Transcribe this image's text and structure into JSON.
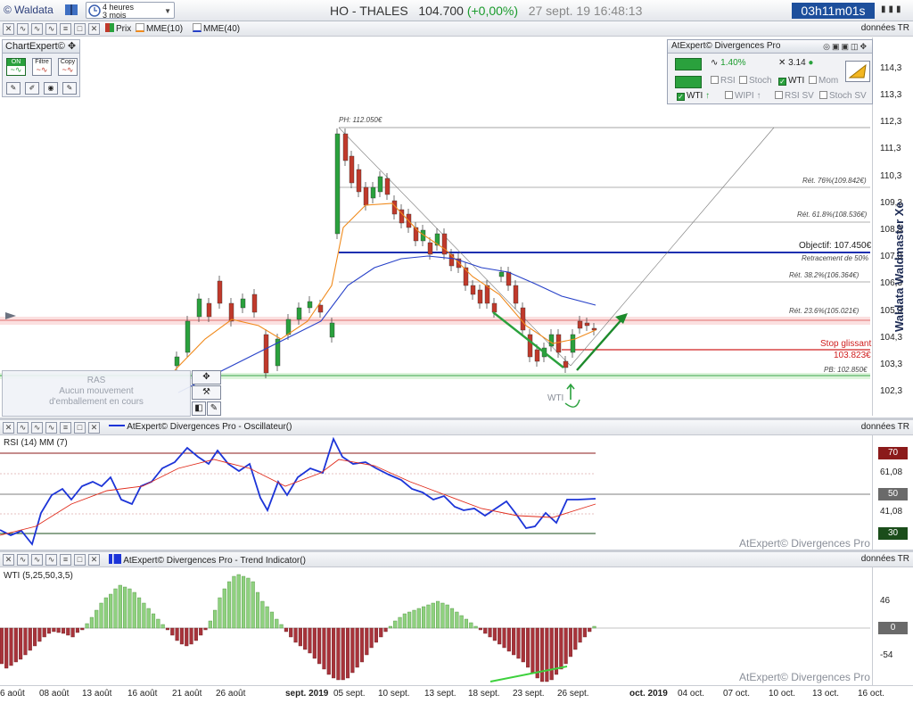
{
  "app": {
    "name": "© Waldata"
  },
  "period": {
    "line1": "4 heures",
    "line2": "3 mois"
  },
  "instrument": {
    "name": "HO - THALES",
    "price": "104.700",
    "change": "(+0,00%)",
    "datetime": "27 sept. 19 16:48:13"
  },
  "timer": "03h11m01s",
  "main_legend": {
    "price": "Prix",
    "ema10": "MME(10)",
    "ema40": "MME(40)",
    "realtime": "données TR"
  },
  "colors": {
    "ema10": "#f08a1c",
    "ema40": "#2640c8",
    "bull": "#2aa13d",
    "bear": "#c0392b",
    "rsi": "#1c34d8",
    "rsi_signal": "#e02a1a",
    "wti_up": "#8fd17f",
    "wti_down": "#a8333a",
    "timer_bg": "#1d4f9c"
  },
  "chartexpert": {
    "title": "ChartExpert©",
    "on": "ON",
    "filter": "Filtre",
    "copy": "Copy"
  },
  "atexpert": {
    "title": "AtExpert© Divergences Pro",
    "pct": "1.40%",
    "val": "3.14",
    "rsi": "RSI",
    "stoch": "Stoch",
    "wti": "WTI",
    "mom": "Mom",
    "wti2": "WTI",
    "wipi": "WIPI",
    "rsisv": "RSI SV",
    "stochsv": "Stoch SV"
  },
  "ras": {
    "title": "RAS",
    "line1": "Aucun mouvement",
    "line2": "d'emballement en cours"
  },
  "annotations": {
    "ph": "PH: 112.050€",
    "r76": "Rét. 76%(109.842€)",
    "r618": "Rét. 61.8%(108.536€)",
    "objectif": "Objectif: 107.450€",
    "retr50": "Retracement de 50%",
    "r382": "Rét. 38.2%(106.364€)",
    "r236": "Rét. 23.6%(105.021€)",
    "stop1": "Stop glissant",
    "stop2": "103.823€",
    "pb": "PB: 102.850€",
    "wti": "WTI"
  },
  "price_axis": [
    "114,3",
    "113,3",
    "112,3",
    "111,3",
    "110,3",
    "109,3",
    "108,3",
    "107,3",
    "106,3",
    "105,3",
    "104,3",
    "103,3",
    "102,3"
  ],
  "watermark_side": "Waldata Waldmaster Xe",
  "rsi_panel": {
    "title": "AtExpert© Divergences Pro - Oscillateur()",
    "label": "RSI (14) MM (7)",
    "realtime": "données TR",
    "axis": [
      "70",
      "61,08",
      "50",
      "41,08",
      "30"
    ],
    "watermark": "AtExpert© Divergences Pro"
  },
  "wti_panel": {
    "title": "AtExpert© Divergences Pro - Trend Indicator()",
    "label": "WTI (5,25,50,3,5)",
    "realtime": "données TR",
    "axis": [
      "46",
      "0",
      "-54"
    ],
    "watermark": "AtExpert© Divergences Pro"
  },
  "x_axis": [
    "6 août",
    "08 août",
    "13 août",
    "16 août",
    "21 août",
    "26 août",
    "sept. 2019",
    "05 sept.",
    "10 sept.",
    "13 sept.",
    "18 sept.",
    "23 sept.",
    "26 sept.",
    "oct. 2019",
    "04 oct.",
    "07 oct.",
    "10 oct.",
    "13 oct.",
    "16 oct."
  ]
}
